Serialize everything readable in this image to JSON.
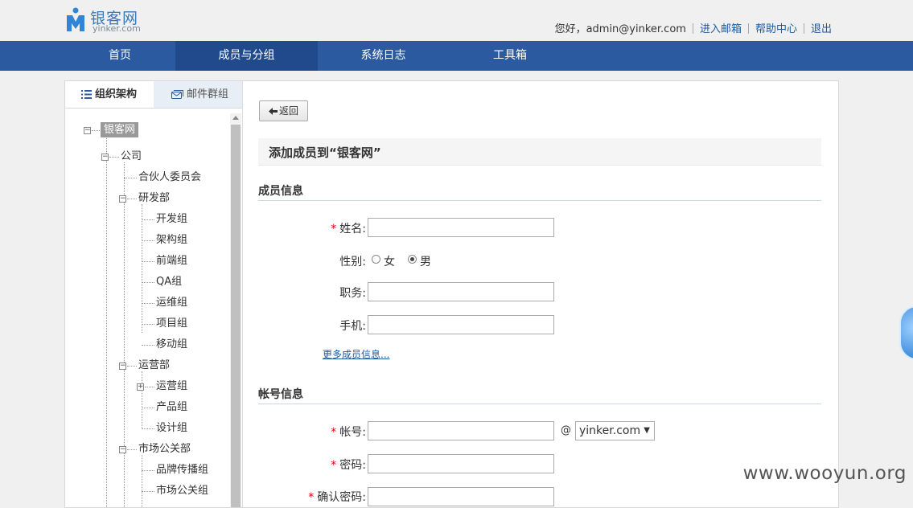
{
  "brand": {
    "name_cn": "银客网",
    "name_en": "yinker.com",
    "accent": "#2c5aa0"
  },
  "userbar": {
    "greeting": "您好，admin@yinker.com",
    "links": [
      "进入邮箱",
      "帮助中心",
      "退出"
    ]
  },
  "nav": {
    "items": [
      "首页",
      "成员与分组",
      "系统日志",
      "工具箱"
    ],
    "active": "成员与分组"
  },
  "sidebar": {
    "tabs": [
      "组织架构",
      "邮件群组"
    ],
    "active_tab": "组织架构",
    "tree": {
      "root": "银客网",
      "company": "公司",
      "partner": "合伙人委员会",
      "rd": "研发部",
      "rd_children": [
        "开发组",
        "架构组",
        "前端组",
        "QA组",
        "运维组",
        "项目组",
        "移动组"
      ],
      "ops": "运营部",
      "ops_children": [
        "运营组",
        "产品组",
        "设计组"
      ],
      "mkt": "市场公关部",
      "mkt_children": [
        "品牌传播组",
        "市场公关组"
      ]
    }
  },
  "main": {
    "back_label": "返回",
    "form_title": "添加成员到“银客网”",
    "member_section": "成员信息",
    "account_section": "帐号信息",
    "fields": {
      "name_label": "姓名:",
      "gender_label": "性别:",
      "gender_female": "女",
      "gender_male": "男",
      "gender_selected": "男",
      "position_label": "职务:",
      "mobile_label": "手机:",
      "account_label": "帐号:",
      "password_label": "密码:",
      "confirm_label": "确认密码:"
    },
    "required_mark": "*",
    "more_link": "更多成员信息...",
    "at_sign": "@",
    "domain_selected": "yinker.com",
    "values": {
      "name": "",
      "position": "",
      "mobile": "",
      "account": "",
      "password": "",
      "confirm": ""
    }
  },
  "watermark": "www.wooyun.org"
}
